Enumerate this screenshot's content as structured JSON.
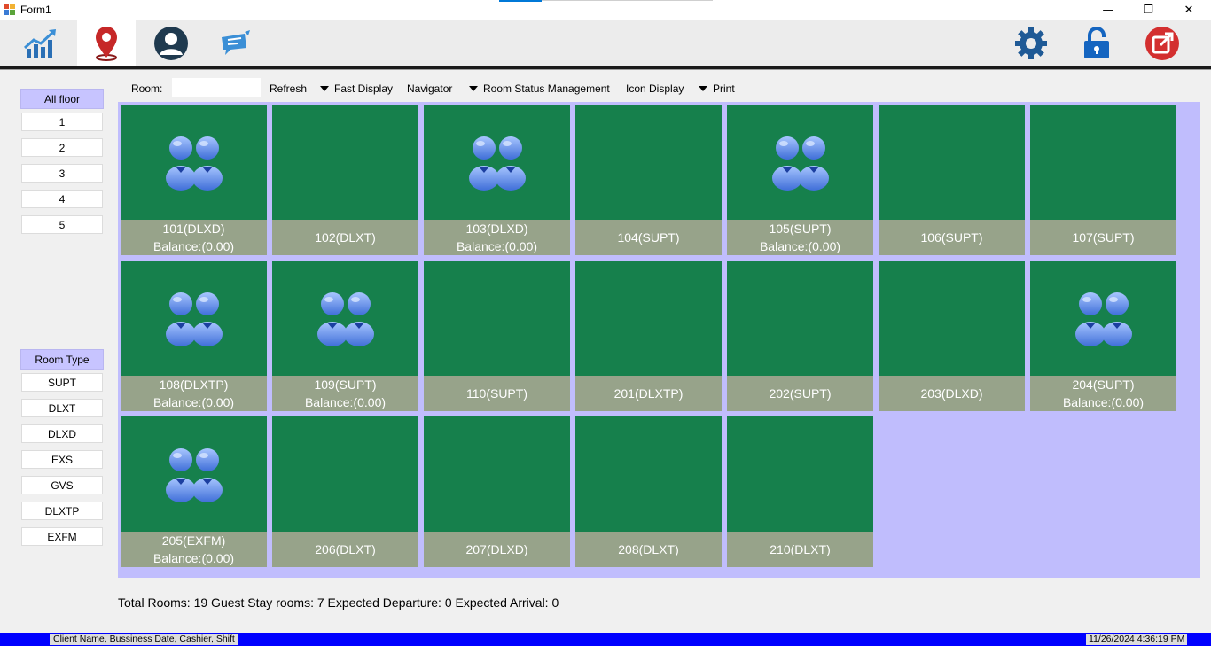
{
  "window": {
    "title": "Form1",
    "minimize_glyph": "—",
    "maximize_glyph": "❐",
    "close_glyph": "✕"
  },
  "toolbar": {
    "left_items": [
      {
        "icon": "chart-icon",
        "active": false
      },
      {
        "icon": "location-pin-icon",
        "active": true
      },
      {
        "icon": "user-icon",
        "active": false
      },
      {
        "icon": "chat-icon",
        "active": false
      }
    ],
    "right_items": [
      {
        "icon": "gear-icon"
      },
      {
        "icon": "lock-icon"
      },
      {
        "icon": "exit-icon"
      }
    ]
  },
  "sidebar": {
    "floor_header": "All floor",
    "floors": [
      "1",
      "2",
      "3",
      "4",
      "5"
    ],
    "type_header": "Room Type",
    "room_types": [
      "SUPT",
      "DLXT",
      "DLXD",
      "EXS",
      "GVS",
      "DLXTP",
      "EXFM"
    ]
  },
  "subtoolbar": {
    "room_label": "Room:",
    "room_value": "",
    "refresh": "Refresh",
    "fast_display": "Fast Display",
    "navigator": "Navigator",
    "room_status": "Room Status Management",
    "icon_display": "Icon Display",
    "print": "Print"
  },
  "rooms": [
    {
      "name": "101(DLXD)",
      "balance": "Balance:(0.00)",
      "occupied": true
    },
    {
      "name": "102(DLXT)",
      "balance": "",
      "occupied": false
    },
    {
      "name": "103(DLXD)",
      "balance": "Balance:(0.00)",
      "occupied": true
    },
    {
      "name": "104(SUPT)",
      "balance": "",
      "occupied": false
    },
    {
      "name": "105(SUPT)",
      "balance": "Balance:(0.00)",
      "occupied": true
    },
    {
      "name": "106(SUPT)",
      "balance": "",
      "occupied": false
    },
    {
      "name": "107(SUPT)",
      "balance": "",
      "occupied": false
    },
    {
      "name": "108(DLXTP)",
      "balance": "Balance:(0.00)",
      "occupied": true
    },
    {
      "name": "109(SUPT)",
      "balance": "Balance:(0.00)",
      "occupied": true
    },
    {
      "name": "110(SUPT)",
      "balance": "",
      "occupied": false
    },
    {
      "name": "201(DLXTP)",
      "balance": "",
      "occupied": false
    },
    {
      "name": "202(SUPT)",
      "balance": "",
      "occupied": false
    },
    {
      "name": "203(DLXD)",
      "balance": "",
      "occupied": false
    },
    {
      "name": "204(SUPT)",
      "balance": "Balance:(0.00)",
      "occupied": true
    },
    {
      "name": "205(EXFM)",
      "balance": "Balance:(0.00)",
      "occupied": true
    },
    {
      "name": "206(DLXT)",
      "balance": "",
      "occupied": false
    },
    {
      "name": "207(DLXD)",
      "balance": "",
      "occupied": false
    },
    {
      "name": "208(DLXT)",
      "balance": "",
      "occupied": false
    },
    {
      "name": "210(DLXT)",
      "balance": "",
      "occupied": false
    }
  ],
  "summary": "Total Rooms: 19 Guest Stay rooms: 7 Expected Departure: 0 Expected Arrival: 0",
  "status": {
    "left": "Client Name, Bussiness Date, Cashier, Shift",
    "right": "11/26/2024 4:36:19 PM"
  },
  "colors": {
    "room_tile": "#16804c",
    "room_label_bg": "#97a38a",
    "grid_bg": "#c0bdfd",
    "status_bar": "#0000ff"
  }
}
